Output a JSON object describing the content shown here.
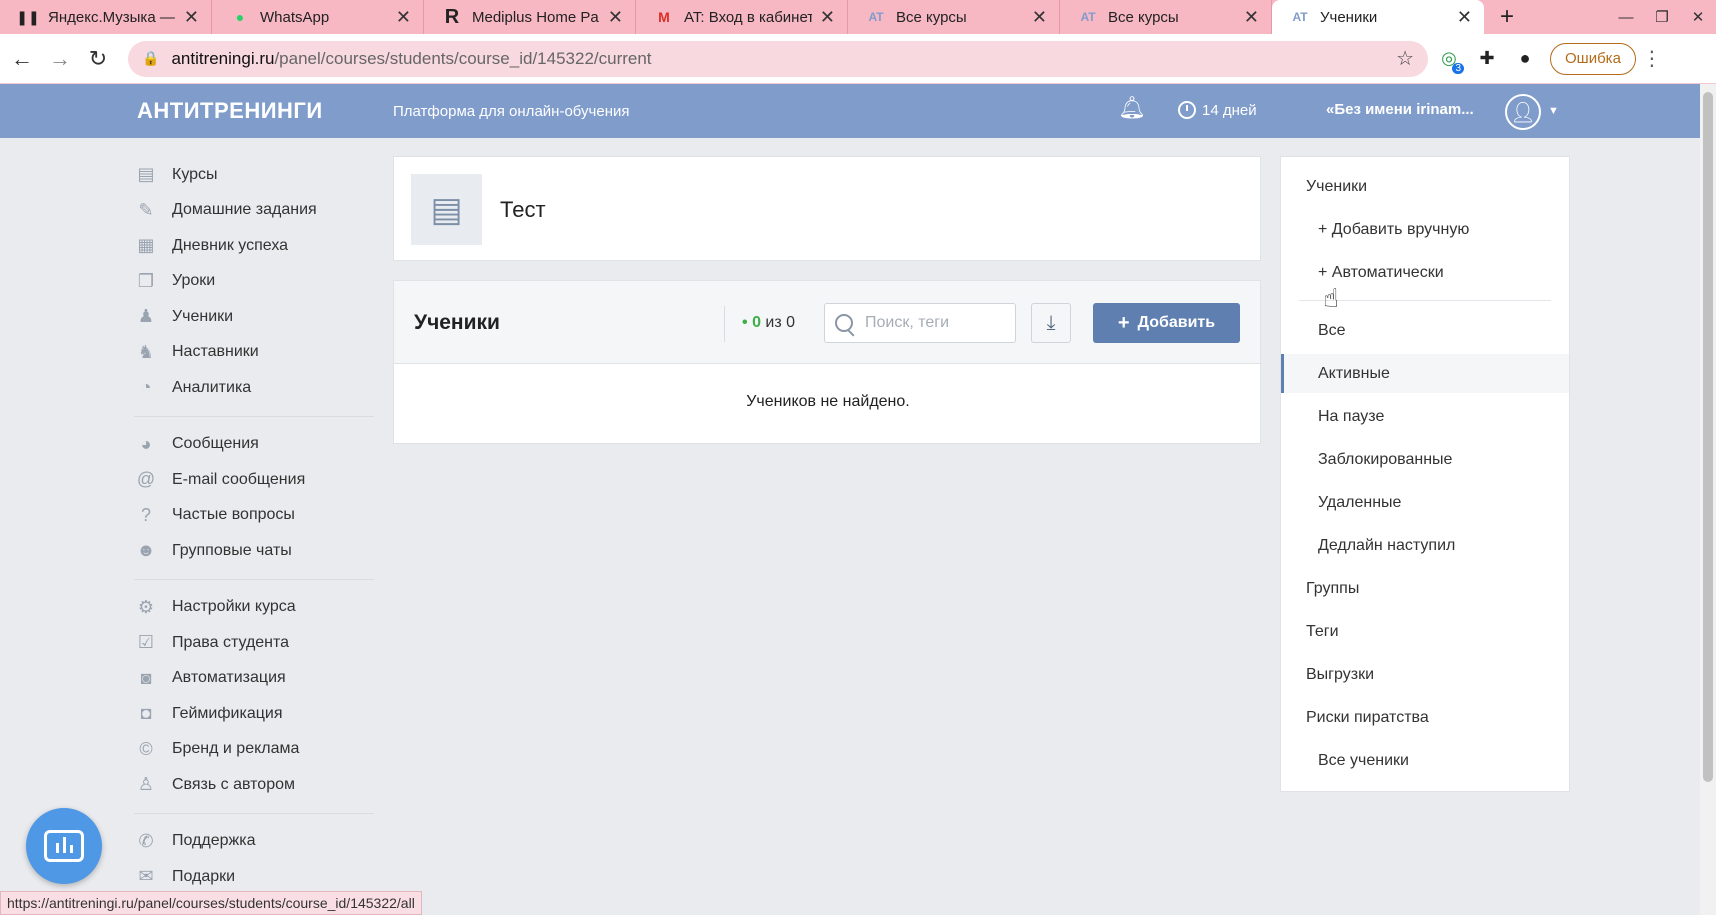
{
  "browser": {
    "tabs": [
      {
        "title": "Яндекс.Музыка —",
        "icon": "pause-icon",
        "active": false
      },
      {
        "title": "WhatsApp",
        "icon": "whatsapp-icon",
        "active": false
      },
      {
        "title": "Mediplus Home Pa",
        "icon": "r-logo-icon",
        "active": false
      },
      {
        "title": "AT: Вход в кабинет",
        "icon": "gmail-icon",
        "active": false
      },
      {
        "title": "Все курсы",
        "icon": "at-icon",
        "active": false
      },
      {
        "title": "Все курсы",
        "icon": "at-icon",
        "active": false
      },
      {
        "title": "Ученики",
        "icon": "at-icon",
        "active": true
      }
    ],
    "url_domain": "antitreningi.ru",
    "url_path": "/panel/courses/students/course_id/145322/current",
    "extension_badge": "3",
    "error_button": "Ошибка",
    "status_url": "https://antitreningi.ru/panel/courses/students/course_id/145322/all"
  },
  "header": {
    "logo": "АНТИТРЕНИНГИ",
    "tagline": "Платформа для онлайн-обучения",
    "trial": "14 дней",
    "username": "«Без имени irinam..."
  },
  "sidebar": {
    "group1": [
      {
        "label": "Курсы",
        "icon": "books-icon"
      },
      {
        "label": "Домашние задания",
        "icon": "edit-icon"
      },
      {
        "label": "Дневник успеха",
        "icon": "journal-icon"
      },
      {
        "label": "Уроки",
        "icon": "book-open-icon"
      },
      {
        "label": "Ученики",
        "icon": "students-icon"
      },
      {
        "label": "Наставники",
        "icon": "mentors-icon"
      },
      {
        "label": "Аналитика",
        "icon": "pie-chart-icon"
      }
    ],
    "group2": [
      {
        "label": "Сообщения",
        "icon": "messages-icon"
      },
      {
        "label": "E-mail сообщения",
        "icon": "at-sign-icon"
      },
      {
        "label": "Частые вопросы",
        "icon": "question-icon"
      },
      {
        "label": "Групповые чаты",
        "icon": "group-chat-icon"
      }
    ],
    "group3": [
      {
        "label": "Настройки курса",
        "icon": "gear-icon"
      },
      {
        "label": "Права студента",
        "icon": "checkbox-icon"
      },
      {
        "label": "Автоматизация",
        "icon": "robot-icon"
      },
      {
        "label": "Геймификация",
        "icon": "gamepad-icon"
      },
      {
        "label": "Бренд и реклама",
        "icon": "copyright-icon"
      },
      {
        "label": "Связь с автором",
        "icon": "user-icon"
      }
    ],
    "group4": [
      {
        "label": "Поддержка",
        "icon": "phone-icon"
      },
      {
        "label": "Подарки",
        "icon": "gift-icon"
      }
    ]
  },
  "course": {
    "title": "Тест"
  },
  "students": {
    "title": "Ученики",
    "count_active": "0",
    "count_sep": "из",
    "count_total": "0",
    "search_placeholder": "Поиск, теги",
    "add_button": "Добавить",
    "empty_message": "Учеников не найдено."
  },
  "right_menu": {
    "students_header": "Ученики",
    "add_manual": "+ Добавить вручную",
    "add_auto": "+ Автоматически",
    "filters": [
      "Все",
      "Активные",
      "На паузе",
      "Заблокированные",
      "Удаленные",
      "Дедлайн наступил"
    ],
    "active_filter": "Активные",
    "groups": "Группы",
    "tags": "Теги",
    "exports": "Выгрузки",
    "piracy": "Риски пиратства",
    "all_students": "Все ученики"
  },
  "colors": {
    "header_bg": "#7f9ccb",
    "accent_button": "#5e7fb0",
    "active_green": "#3fae49",
    "browser_tab_bg": "#f7b8c4"
  }
}
